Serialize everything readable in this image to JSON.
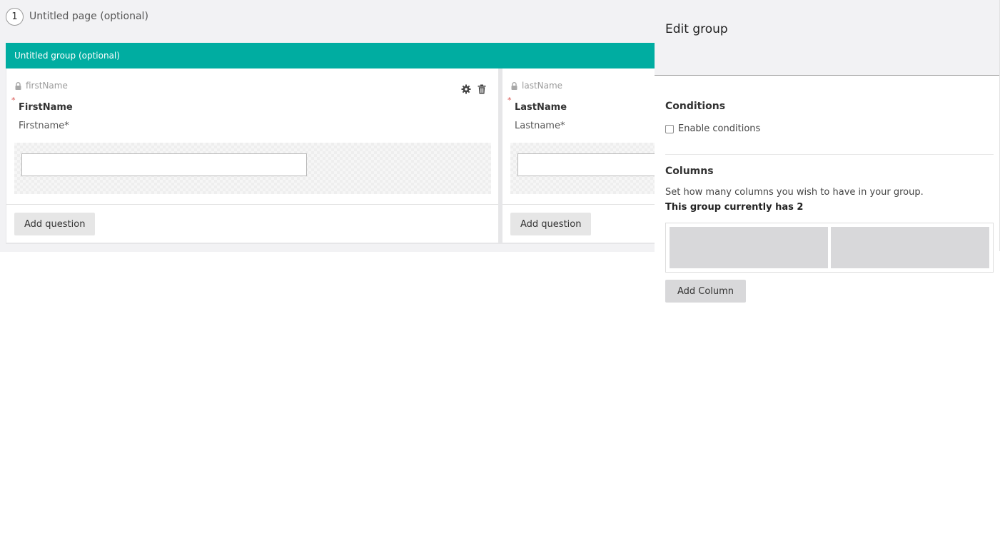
{
  "page": {
    "number": "1",
    "title": "Untitled page (optional)"
  },
  "group": {
    "title": "Untitled group (optional)",
    "columns": [
      {
        "alias": "firstName",
        "required_mark": "*",
        "question_title": "FirstName",
        "question_label": "Firstname*",
        "add_question_label": "Add question"
      },
      {
        "alias": "lastName",
        "required_mark": "*",
        "question_title": "LastName",
        "question_label": "Lastname*",
        "add_question_label": "Add question"
      }
    ]
  },
  "panel": {
    "title": "Edit group",
    "conditions": {
      "heading": "Conditions",
      "checkbox_label": "Enable conditions",
      "checked": false
    },
    "columns": {
      "heading": "Columns",
      "description": "Set how many columns you wish to have in your group.",
      "count_text": "This group currently has 2",
      "count": 2,
      "add_button_label": "Add Column"
    }
  },
  "colors": {
    "group_header": "#00ada1",
    "required": "#d9534f",
    "workspace_bg": "#f2f2f4",
    "button_bg": "#e6e6e6"
  },
  "icons": {
    "lock": "lock-icon",
    "settings": "gear-icon",
    "delete": "trash-icon"
  }
}
